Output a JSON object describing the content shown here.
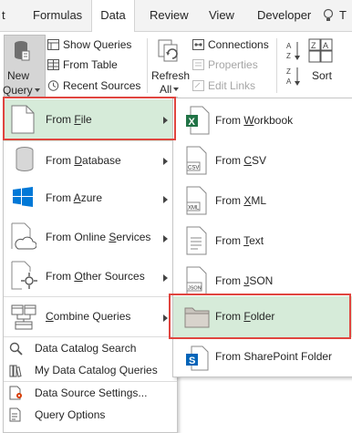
{
  "tabs": [
    {
      "label": "t",
      "active": false
    },
    {
      "label": "Formulas",
      "active": false
    },
    {
      "label": "Data",
      "active": true
    },
    {
      "label": "Review",
      "active": false
    },
    {
      "label": "View",
      "active": false
    },
    {
      "label": "Developer",
      "active": false
    }
  ],
  "tell_me_glyph": "T",
  "ribbon": {
    "new_query_line1": "New",
    "new_query_line2": "Query",
    "show_queries": "Show Queries",
    "from_table": "From Table",
    "recent_sources": "Recent Sources",
    "refresh_line1": "Refresh",
    "refresh_line2": "All",
    "connections": "Connections",
    "properties": "Properties",
    "edit_links": "Edit Links",
    "sort": "Sort"
  },
  "menu1": {
    "items": [
      {
        "label": "From File",
        "accel": "F",
        "has_submenu": true,
        "highlighted": true,
        "icon": "file-icon"
      },
      {
        "label": "From Database",
        "accel": "D",
        "has_submenu": true,
        "icon": "database-icon"
      },
      {
        "label": "From Azure",
        "accel": "A",
        "has_submenu": true,
        "icon": "azure-windows-icon"
      },
      {
        "label": "From Online Services",
        "accel": "S",
        "has_submenu": true,
        "icon": "cloud-icon"
      },
      {
        "label": "From Other Sources",
        "accel": "O",
        "has_submenu": true,
        "icon": "other-sources-icon"
      },
      {
        "label": "Combine Queries",
        "accel": "C",
        "has_submenu": true,
        "icon": "combine-queries-icon"
      }
    ],
    "small_items": [
      {
        "label": "Data Catalog Search",
        "icon": "catalog-search-icon"
      },
      {
        "label": "My Data Catalog Queries",
        "icon": "my-catalog-queries-icon"
      },
      {
        "label": "Data Source Settings...",
        "icon": "data-source-settings-icon"
      },
      {
        "label": "Query Options",
        "icon": "query-options-icon"
      }
    ]
  },
  "menu2": {
    "items": [
      {
        "label": "From Workbook",
        "accel": "W",
        "icon": "excel-workbook-icon"
      },
      {
        "label": "From CSV",
        "accel": "C",
        "icon": "csv-file-icon"
      },
      {
        "label": "From XML",
        "accel": "X",
        "icon": "xml-file-icon"
      },
      {
        "label": "From Text",
        "accel": "T",
        "icon": "text-file-icon"
      },
      {
        "label": "From JSON",
        "accel": "J",
        "icon": "json-file-icon"
      },
      {
        "label": "From Folder",
        "accel": "F",
        "highlighted": true,
        "icon": "folder-icon"
      },
      {
        "label": "From SharePoint Folder",
        "accel": "",
        "icon": "sharepoint-folder-icon"
      }
    ]
  },
  "colors": {
    "highlight": "#d6ebd9",
    "red_outline": "#e0453f",
    "excel_green": "#217346",
    "azure_blue": "#0078d7",
    "sharepoint_blue": "#0364b8"
  }
}
